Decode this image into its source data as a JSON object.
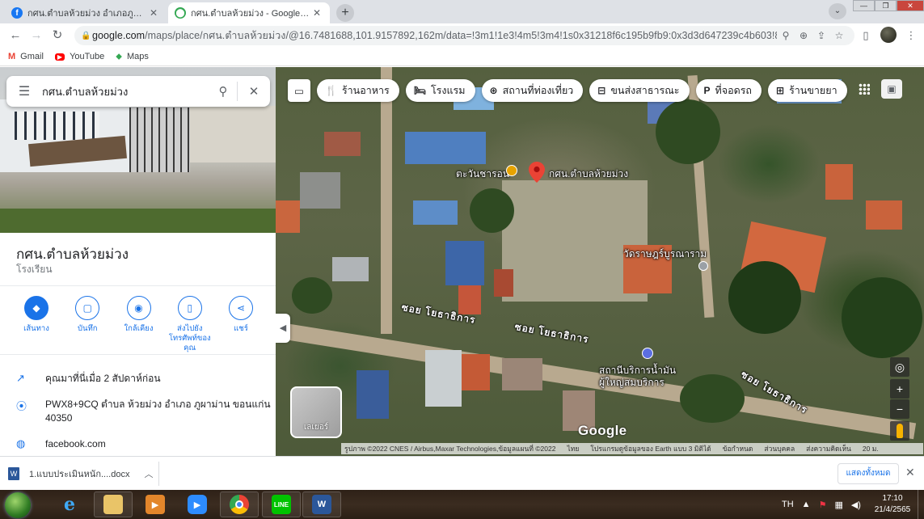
{
  "browser": {
    "tabs": [
      {
        "title": "กศน.ตำบลห้วยม่วง อำเภอภูผาม่าน จังห",
        "favicon": "facebook-icon",
        "active": false
      },
      {
        "title": "กศน.ตำบลห้วยม่วง - Google Maps",
        "favicon": "maps-pin-icon",
        "active": true
      }
    ],
    "new_tab": "+",
    "url_host": "google.com",
    "url_path": "/maps/place/กศน.ตำบลห้วยม่วง/@16.7481688,101.9157892,162m/data=!3m1!1e3!4m5!3m4!1s0x31218f6c195b9fb9:0x3d3d647239c4b603!8m2!3d1...",
    "bookmarks": [
      {
        "label": "Gmail",
        "icon": "gmail-icon"
      },
      {
        "label": "YouTube",
        "icon": "youtube-icon"
      },
      {
        "label": "Maps",
        "icon": "maps-icon"
      }
    ]
  },
  "sidebar": {
    "search_query": "กศน.ตำบลห้วยม่วง",
    "place_name": "กศน.ตำบลห้วยม่วง",
    "place_type": "โรงเรียน",
    "actions": [
      {
        "label": "เส้นทาง",
        "icon": "directions-icon",
        "primary": true
      },
      {
        "label": "บันทึก",
        "icon": "bookmark-icon",
        "primary": false
      },
      {
        "label": "ใกล้เคียง",
        "icon": "nearby-icon",
        "primary": false
      },
      {
        "label": "ส่งไปยังโทรศัพท์ของคุณ",
        "icon": "send-to-phone-icon",
        "primary": false
      },
      {
        "label": "แชร์",
        "icon": "share-icon",
        "primary": false
      }
    ],
    "visited": "คุณมาที่นี่เมื่อ 2 สัปดาห์ก่อน",
    "address": "PWX8+9CQ ตำบล ห้วยม่วง อำเภอ ภูผาม่าน ขอนแก่น 40350",
    "website": "facebook.com"
  },
  "map": {
    "chips": [
      {
        "label": "ร้านอาหาร",
        "icon": "restaurant-icon"
      },
      {
        "label": "โรงแรม",
        "icon": "hotel-icon"
      },
      {
        "label": "สถานที่ท่องเที่ยว",
        "icon": "attractions-icon"
      },
      {
        "label": "ขนส่งสาธารณะ",
        "icon": "transit-icon"
      },
      {
        "label": "ที่จอดรถ",
        "icon": "parking-icon"
      },
      {
        "label": "ร้านขายยา",
        "icon": "pharmacy-icon"
      }
    ],
    "labels": {
      "pin": "กศน.ตำบลห้วยม่วง",
      "poi1": "ตะวันชารอน",
      "temple": "วัดราษฎร์บูรณาราม",
      "street1": "ซอย โยธาธิการ",
      "street2": "ซอย โยธาธิการ",
      "street3": "ซอย โยธาธิการ",
      "gas_station": "สถานีบริการน้ำมัน ผู้ใหญ่สมบริการ"
    },
    "layers_label": "เลเยอร์",
    "google_logo": "Google",
    "attribution": [
      "รูปภาพ ©2022 CNES / Airbus,Maxar Technologies,ข้อมูลแผนที่ ©2022",
      "ไทย",
      "โปรแกรมดูข้อมูลของ Earth แบบ 3 มิติได้",
      "ข้อกำหนด",
      "ส่วนบุคคล",
      "ส่งความคิดเห็น",
      "20 ม."
    ]
  },
  "downloads": {
    "file": "1.แบบประเมินหนัก....docx",
    "show_all": "แสดงทั้งหมด"
  },
  "taskbar": {
    "lang": "TH",
    "time": "17:10",
    "date": "21/4/2565"
  }
}
